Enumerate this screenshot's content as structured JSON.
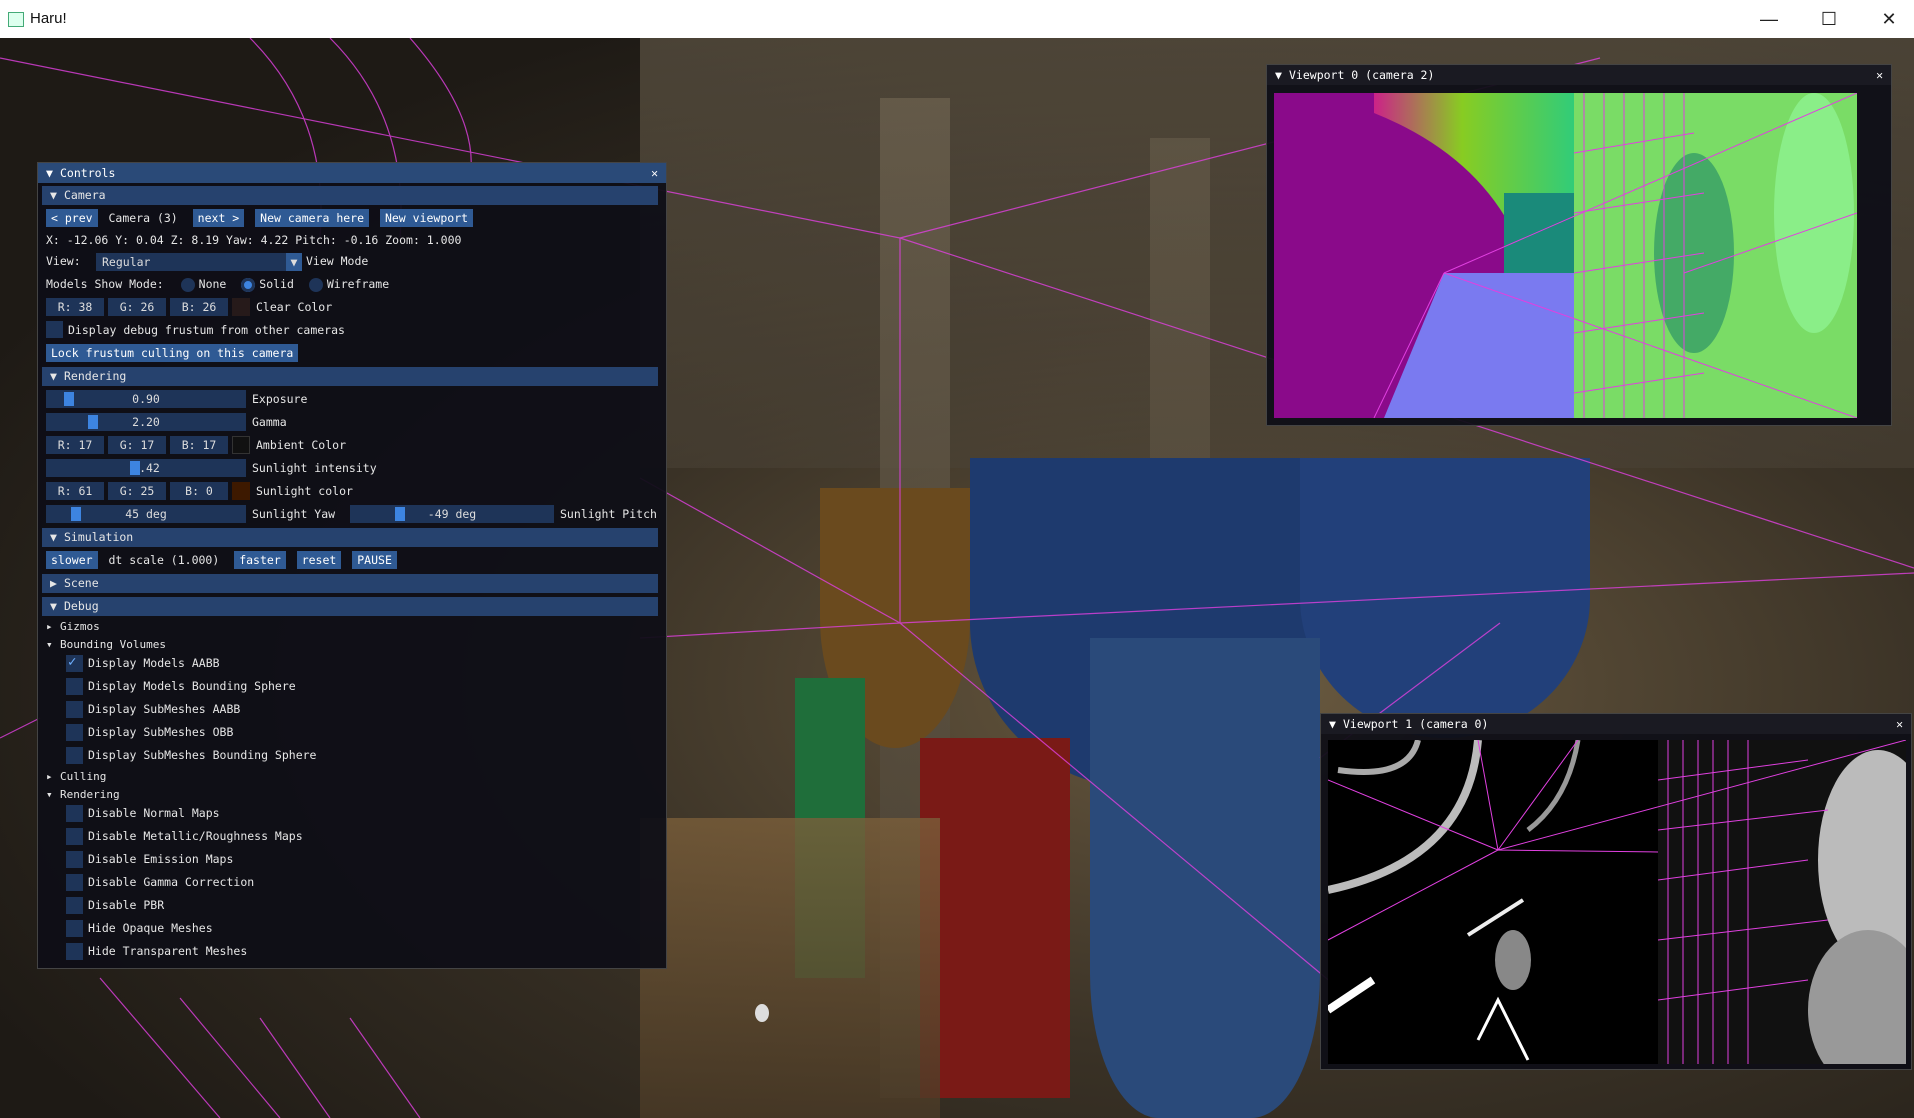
{
  "window": {
    "title": "Haru!",
    "min": "—",
    "max": "☐",
    "close": "✕"
  },
  "controls": {
    "title": "Controls",
    "camera": {
      "header": "Camera",
      "prev": "< prev",
      "current": "Camera (3)",
      "next": "next >",
      "new_camera": "New camera here",
      "new_viewport": "New viewport",
      "coords": "X: -12.06  Y: 0.04  Z: 8.19   Yaw: 4.22  Pitch: -0.16  Zoom: 1.000",
      "view_label": "View:",
      "view_value": "Regular",
      "view_mode": "View Mode",
      "show_mode_label": "Models Show Mode:",
      "mode_none": "None",
      "mode_solid": "Solid",
      "mode_wireframe": "Wireframe",
      "clear_r": "R: 38",
      "clear_g": "G: 26",
      "clear_b": "B: 26",
      "clear_label": "Clear Color",
      "clear_color": "#261a1a",
      "debug_frustum": "Display debug frustum from other cameras",
      "lock_frustum": "Lock frustum culling on this camera"
    },
    "rendering": {
      "header": "Rendering",
      "exposure": "0.90",
      "exposure_label": "Exposure",
      "exposure_level": 0.09,
      "gamma": "2.20",
      "gamma_label": "Gamma",
      "gamma_level": 0.22,
      "amb_r": "R: 17",
      "amb_g": "G: 17",
      "amb_b": "B: 17",
      "amb_label": "Ambient Color",
      "amb_color": "#111111",
      "sun_int": "4.42",
      "sun_int_label": "Sunlight intensity",
      "sun_int_level": 0.44,
      "sun_r": "R: 61",
      "sun_g": "G: 25",
      "sun_b": "B: 0",
      "sun_label": "Sunlight color",
      "sun_color": "#3d1900",
      "yaw": "45 deg",
      "yaw_label": "Sunlight Yaw",
      "yaw_level": 0.125,
      "pitch": "-49 deg",
      "pitch_label": "Sunlight Pitch",
      "pitch_level": 0.23
    },
    "simulation": {
      "header": "Simulation",
      "slower": "slower",
      "dt": "dt scale (1.000)",
      "faster": "faster",
      "reset": "reset",
      "pause": "PAUSE"
    },
    "scene": {
      "header": "Scene"
    },
    "debug": {
      "header": "Debug",
      "gizmos": "Gizmos",
      "bounding": "Bounding Volumes",
      "bv_items": [
        "Display Models AABB",
        "Display Models Bounding Sphere",
        "Display SubMeshes AABB",
        "Display SubMeshes OBB",
        "Display SubMeshes Bounding Sphere"
      ],
      "culling": "Culling",
      "rendering": "Rendering",
      "r_items": [
        "Disable Normal Maps",
        "Disable Metallic/Roughness Maps",
        "Disable Emission Maps",
        "Disable Gamma Correction",
        "Disable PBR",
        "Hide Opaque Meshes",
        "Hide Transparent Meshes"
      ]
    }
  },
  "viewport0": {
    "title": "Viewport 0 (camera 2)"
  },
  "viewport1": {
    "title": "Viewport 1 (camera 0)"
  },
  "colors": {
    "accent": "#3d84e0",
    "header": "#26426e",
    "wire": "#e040e0"
  }
}
